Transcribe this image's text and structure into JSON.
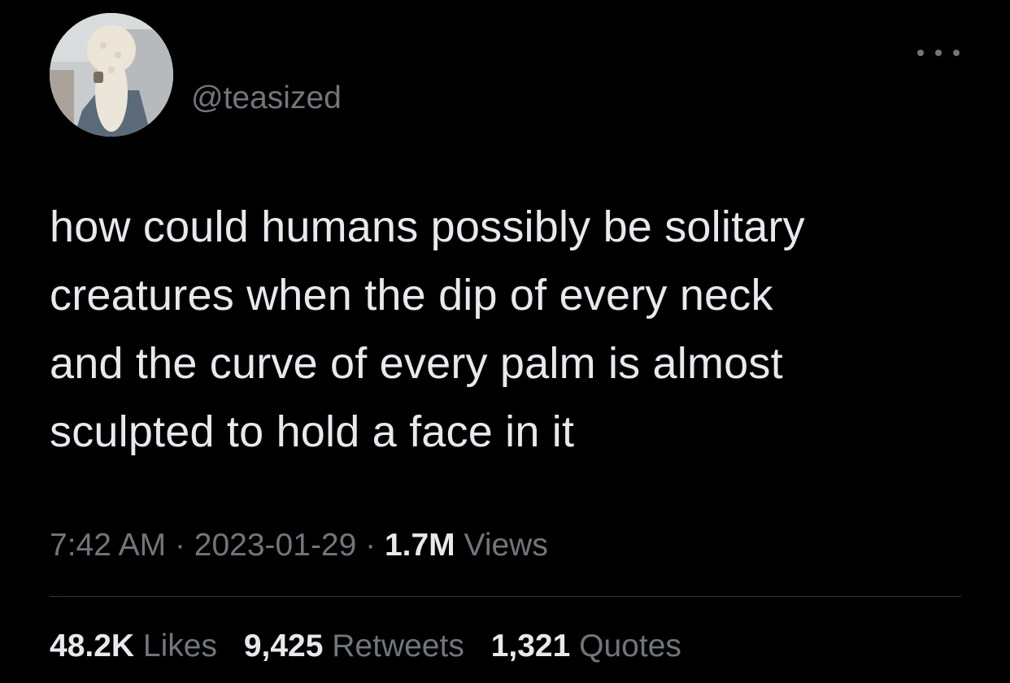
{
  "tweet": {
    "handle": "@teasized",
    "avatar_icon": "profile-photo-avatar",
    "more_icon": "more-options-icon",
    "text_lines": [
      "how could humans possibly be solitary",
      "creatures when the dip of every neck",
      "and the curve of every palm is almost",
      "sculpted to hold a face in it"
    ],
    "time": "7:42 AM",
    "separator": "·",
    "date": "2023-01-29",
    "views_count": "1.7M",
    "views_label": "Views",
    "stats": {
      "likes_count": "48.2K",
      "likes_label": "Likes",
      "retweets_count": "9,425",
      "retweets_label": "Retweets",
      "quotes_count": "1,321",
      "quotes_label": "Quotes"
    }
  },
  "colors": {
    "background": "#000000",
    "primary_text": "#e7e9ea",
    "secondary_text": "#71767b",
    "divider": "#2f3336"
  }
}
